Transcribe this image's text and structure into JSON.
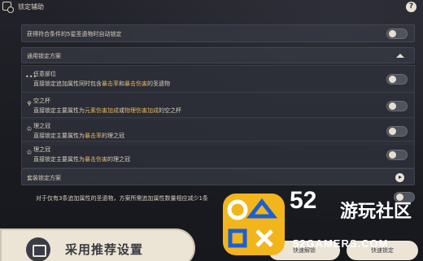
{
  "header": {
    "title": "锁定辅助",
    "help_label": "?"
  },
  "auto_lock": {
    "label": "获得符合条件的5星圣遗物时自动锁定"
  },
  "general_scheme": {
    "title": "通用锁定方案"
  },
  "schemes": [
    {
      "icon": "dots-icon",
      "glyph": "•••",
      "title": "任意部位",
      "desc_pre": "直接锁定追加属性同时包含",
      "hl1": "暴击率",
      "desc_mid": "和",
      "hl2": "暴击伤害",
      "desc_post": "的圣遗物"
    },
    {
      "icon": "goblet-icon",
      "glyph": "♆",
      "title": "空之杯",
      "desc_pre": "直接锁定主要属性为",
      "hl1": "元素伤害加成",
      "desc_mid": "或",
      "hl2": "物理伤害加成",
      "desc_post": "的空之杯"
    },
    {
      "icon": "circlet-icon",
      "glyph": "♔",
      "title": "理之冠",
      "desc_pre": "直接锁定主要属性为",
      "hl1": "暴击率",
      "desc_mid": "",
      "hl2": "",
      "desc_post": "的理之冠"
    },
    {
      "icon": "circlet-icon",
      "glyph": "♔",
      "title": "理之冠",
      "desc_pre": "直接锁定主要属性为",
      "hl1": "暴击伤害",
      "desc_mid": "",
      "hl2": "",
      "desc_post": "的理之冠"
    }
  ],
  "set_scheme": {
    "title": "套装锁定方案"
  },
  "note": {
    "text": "对于仅有3条追加属性的圣遗物，方案所需追加属性数量相应减少1条"
  },
  "footer": {
    "recommend_label": "采用推荐设置",
    "quick_unlock_label": "快速解锁",
    "quick_lock_label": "快速锁定"
  },
  "watermark": {
    "number": "52",
    "cn": "游玩社区",
    "site": "52GAMERS.COM"
  },
  "colors": {
    "highlight": "#e6b45c",
    "panel": "#363842",
    "text": "#d8cfbd"
  }
}
